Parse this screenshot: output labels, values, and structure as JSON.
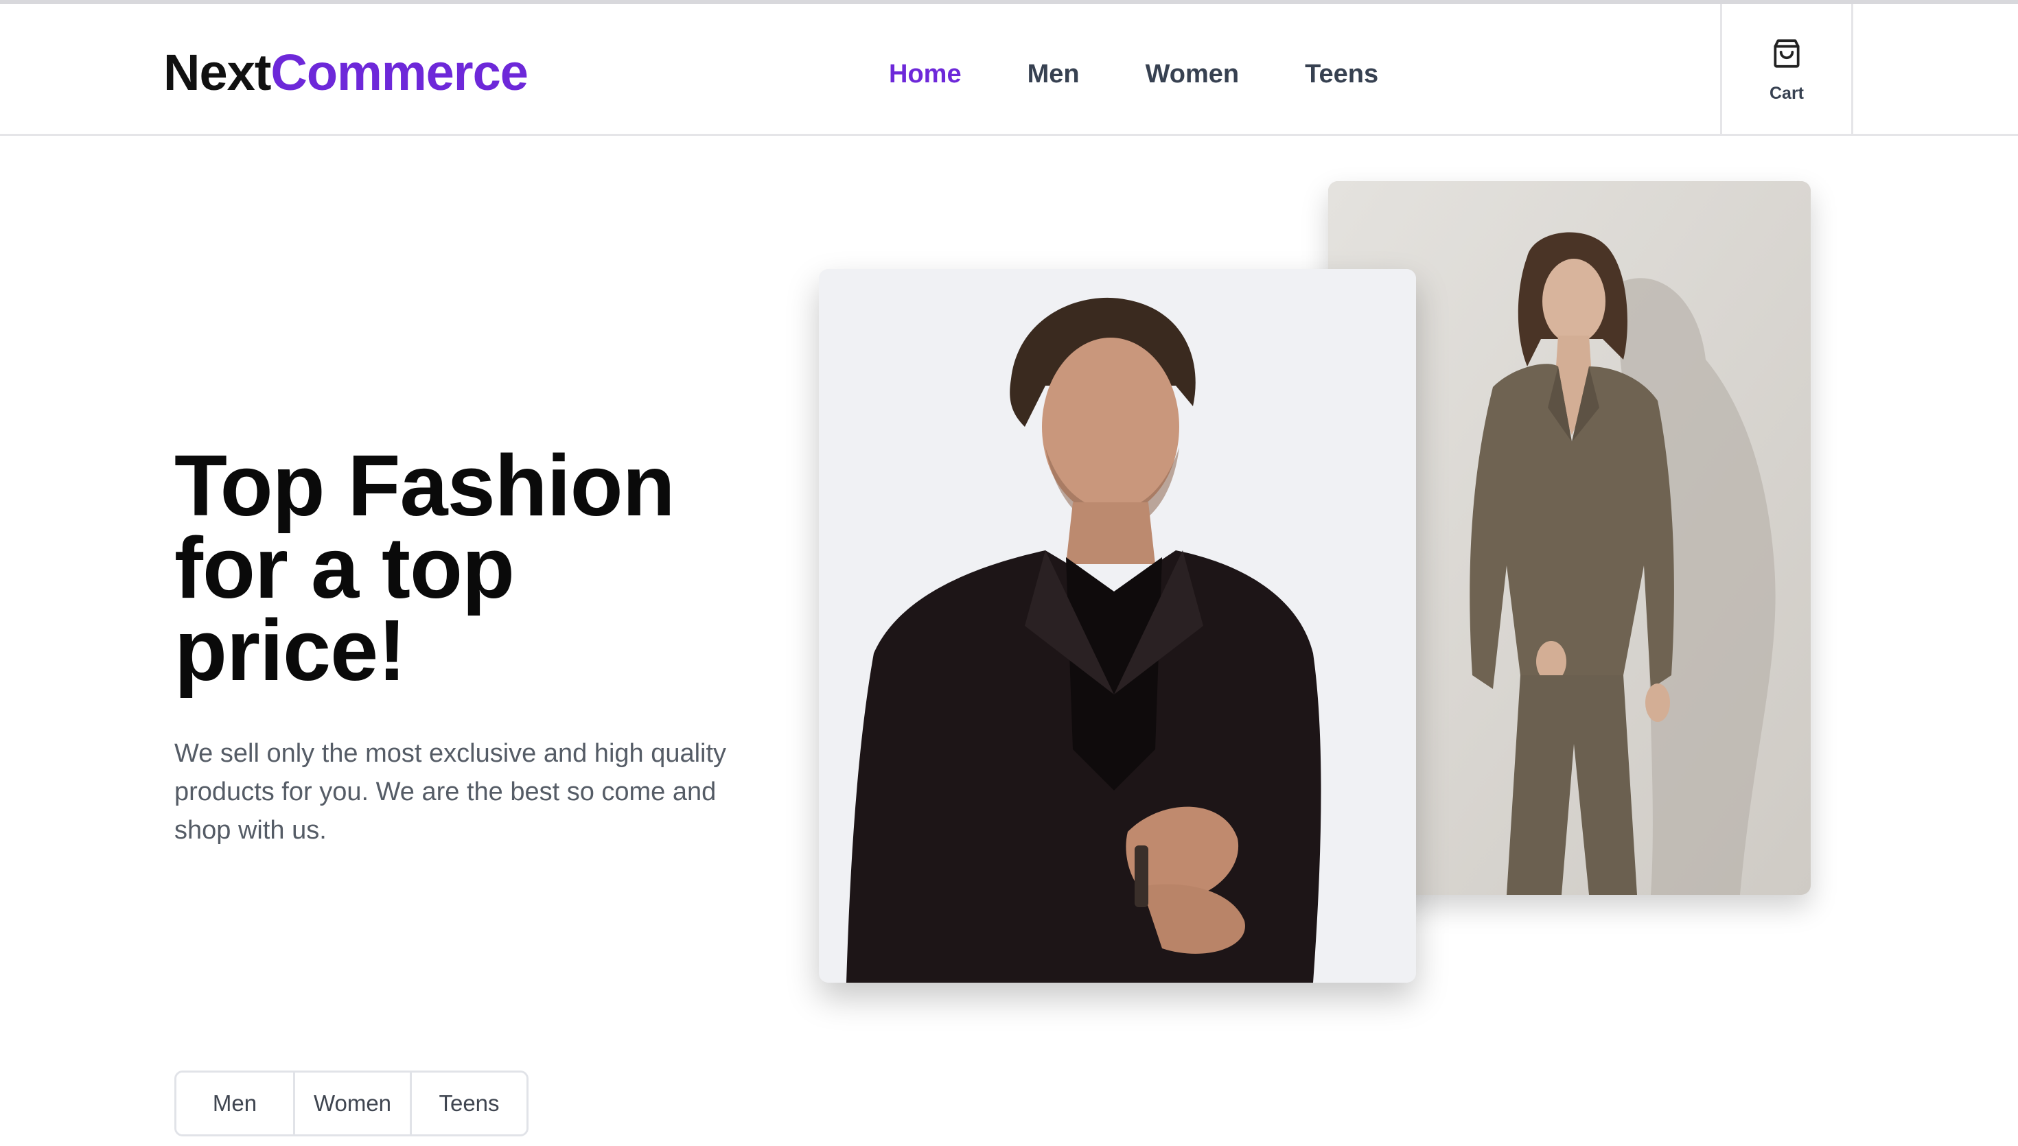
{
  "brand": {
    "part1": "Next",
    "part2": "Commerce",
    "color_part1": "#111111",
    "color_part2": "#6d28d9"
  },
  "nav": {
    "items": [
      {
        "label": "Home",
        "active": true
      },
      {
        "label": "Men",
        "active": false
      },
      {
        "label": "Women",
        "active": false
      },
      {
        "label": "Teens",
        "active": false
      }
    ]
  },
  "cart": {
    "icon": "shopping-bag-icon",
    "label": "Cart"
  },
  "hero": {
    "headline": "Top Fashion for a top price!",
    "subtext": "We sell only the most exclusive and high quality products for you. We are the best so come and shop with us.",
    "images": [
      {
        "name": "man-in-black-suit-photo"
      },
      {
        "name": "woman-in-brown-suit-photo"
      }
    ]
  },
  "categories": {
    "buttons": [
      "Men",
      "Women",
      "Teens"
    ]
  },
  "colors": {
    "accent": "#6d28d9",
    "text_muted": "#555c66",
    "border": "#e5e5e8"
  }
}
